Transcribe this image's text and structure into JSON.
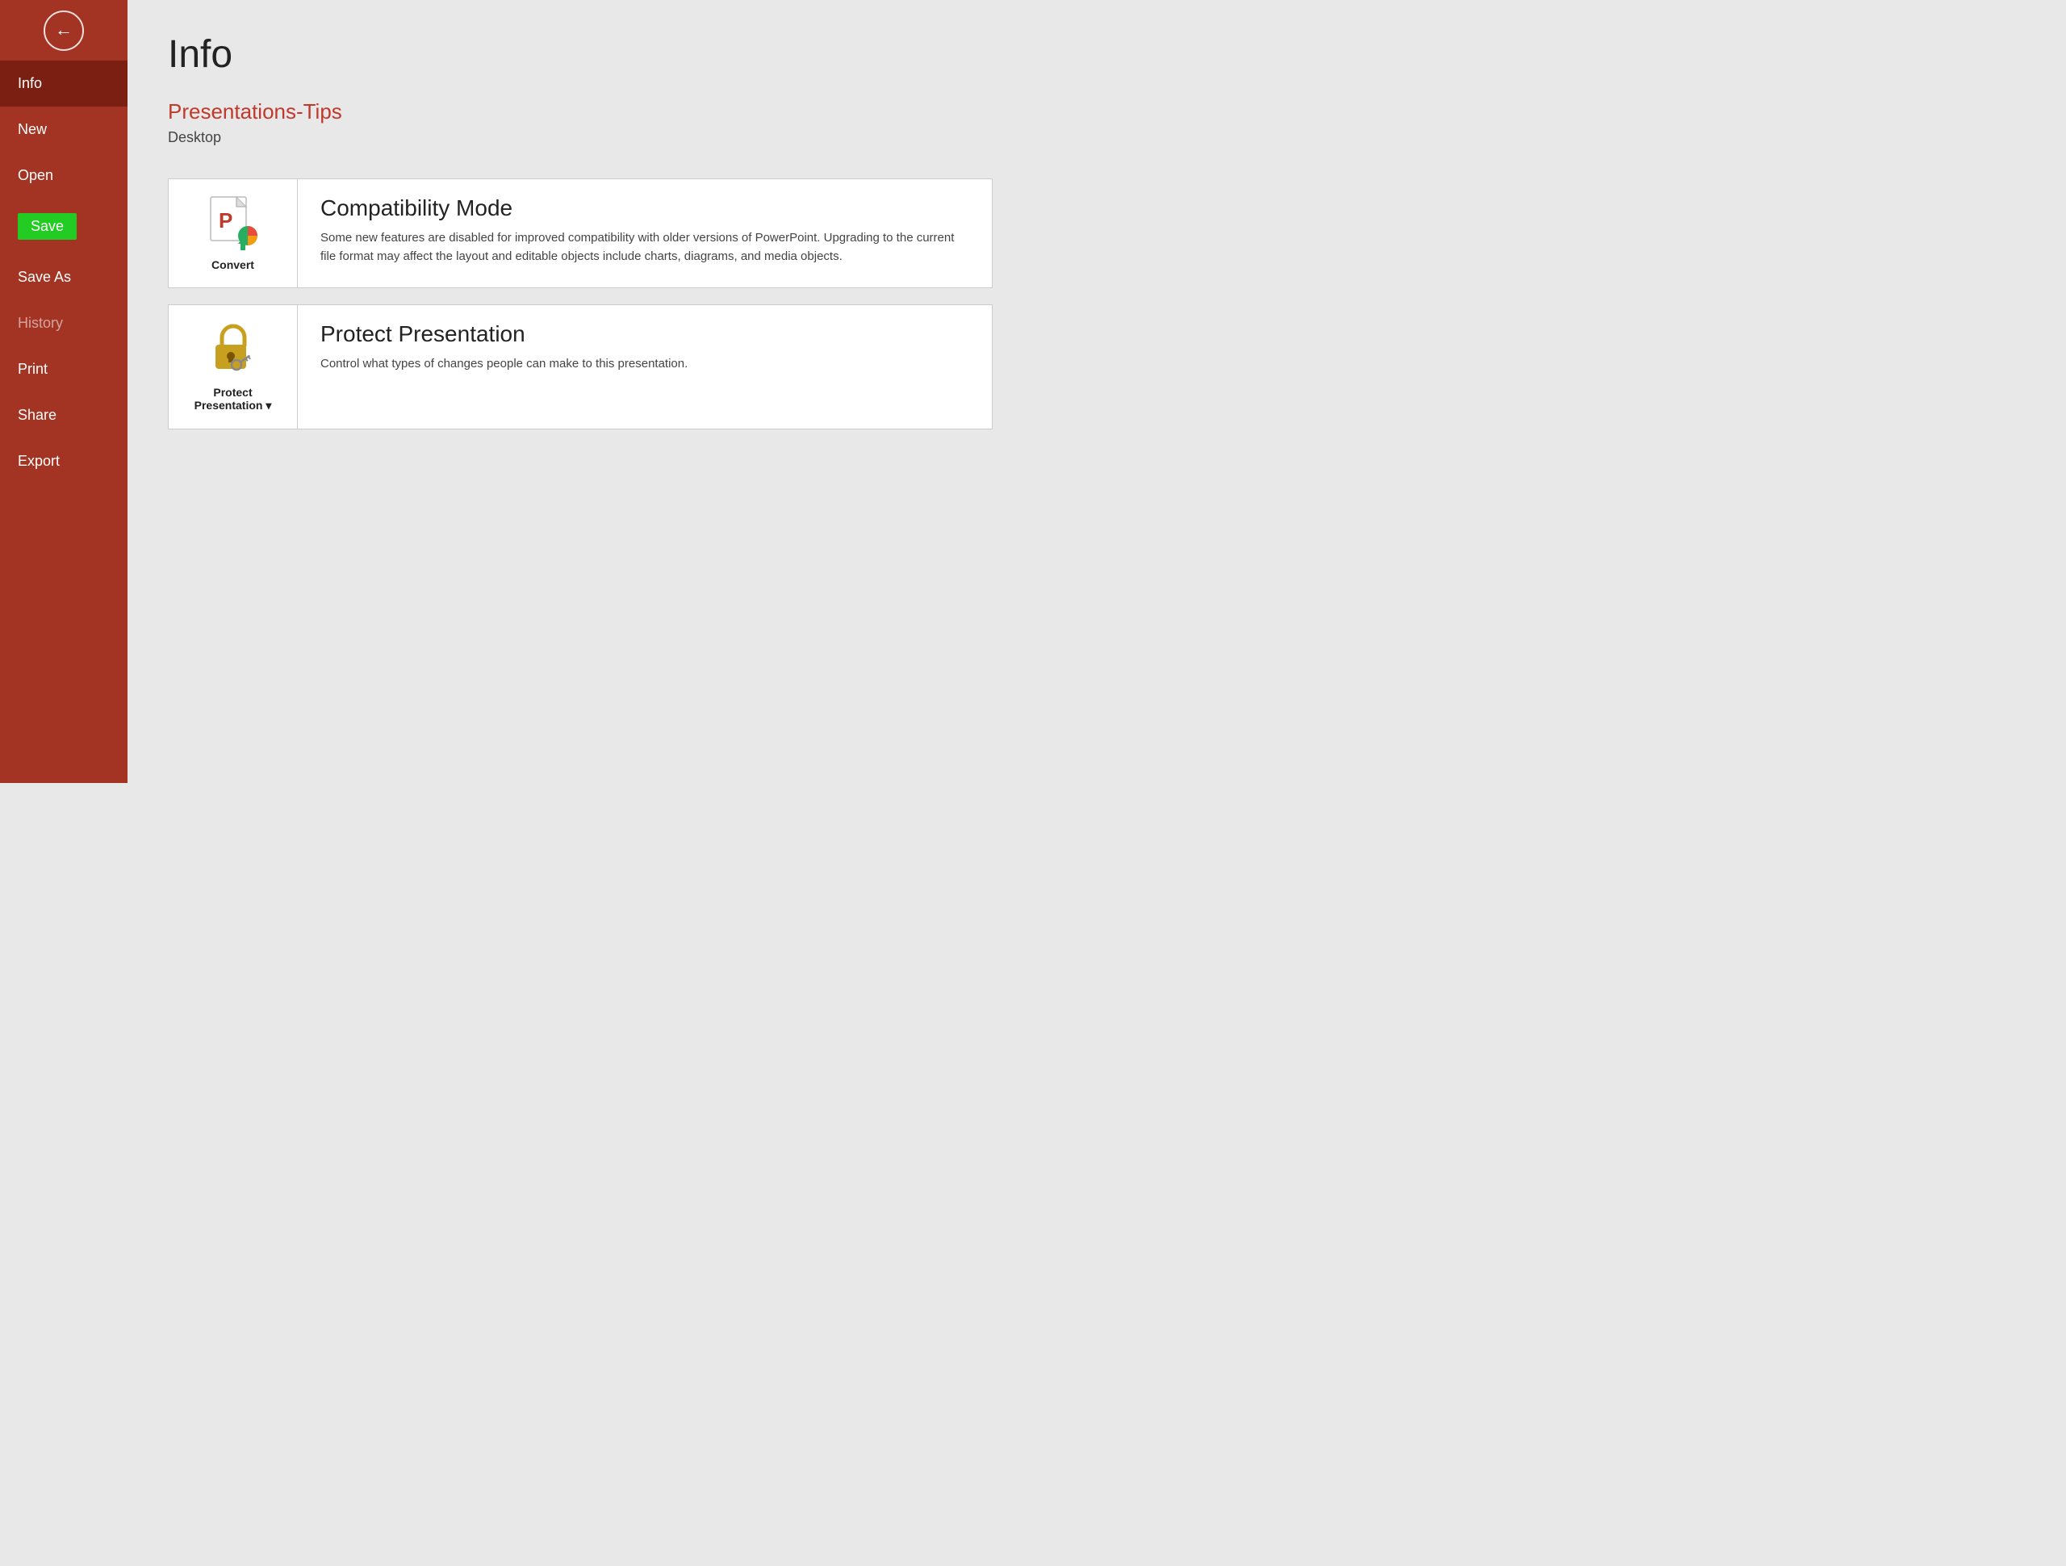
{
  "sidebar": {
    "back_button_label": "Back",
    "items": [
      {
        "id": "info",
        "label": "Info",
        "state": "active"
      },
      {
        "id": "new",
        "label": "New",
        "state": "normal"
      },
      {
        "id": "open",
        "label": "Open",
        "state": "normal"
      },
      {
        "id": "save",
        "label": "Save",
        "state": "highlighted"
      },
      {
        "id": "save-as",
        "label": "Save As",
        "state": "normal"
      },
      {
        "id": "history",
        "label": "History",
        "state": "dimmed"
      },
      {
        "id": "print",
        "label": "Print",
        "state": "normal"
      },
      {
        "id": "share",
        "label": "Share",
        "state": "normal"
      },
      {
        "id": "export",
        "label": "Export",
        "state": "normal"
      }
    ]
  },
  "main": {
    "page_title": "Info",
    "file_name": "Presentations-Tips",
    "file_location": "Desktop",
    "cards": [
      {
        "id": "convert",
        "icon_label": "Convert",
        "title": "Compatibility Mode",
        "description": "Some new features are disabled for improved compatibility with older versions of PowerPoint. Upgrading to the current file format may affect the layout and editable objects include charts, diagrams, and media objects."
      },
      {
        "id": "protect",
        "icon_label": "Protect\nPresentation",
        "title": "Protect Presentation",
        "description": "Control what types of changes people can make to this presentation."
      }
    ]
  }
}
